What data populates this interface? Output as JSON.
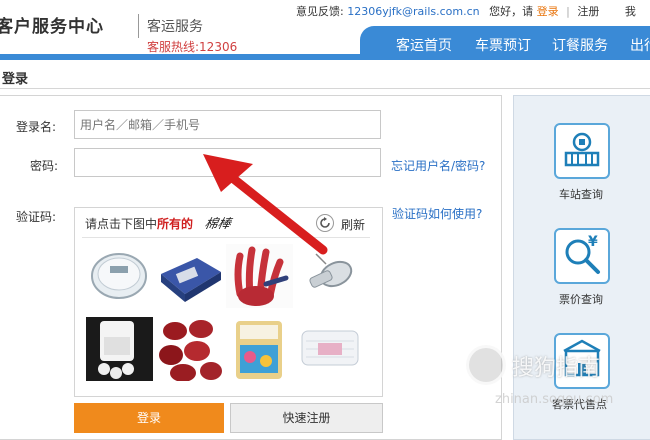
{
  "header": {
    "brand": "客户服务中心",
    "subtitle": "客运服务",
    "hotline": "客服热线:12306",
    "feedback_label": "意见反馈:",
    "feedback_email": "12306yjfk@rails.com.cn",
    "greeting": "您好，请",
    "login_link": "登录",
    "separator": "|",
    "register_link": "注册",
    "cut_link": "我"
  },
  "nav": {
    "items": [
      {
        "label": "客运首页"
      },
      {
        "label": "车票预订"
      },
      {
        "label": "订餐服务"
      },
      {
        "label": "出行"
      }
    ]
  },
  "section_title": "登录",
  "login": {
    "username_label": "登录名:",
    "username_placeholder": "用户名／邮箱／手机号",
    "password_label": "密码:",
    "forgot_link": "忘记用户名/密码?",
    "captcha_label": "验证码:",
    "captcha_help_link": "验证码如何使用?",
    "captcha_prompt_pre": "请点击下图中",
    "captcha_prompt_em": "所有的",
    "captcha_word": "棉棒",
    "refresh_label": "刷新",
    "captcha_images": [
      "scale",
      "calculator",
      "handprint",
      "whistle",
      "pill-bottle",
      "red-dates",
      "cotton-swab-box",
      "cotton-swab-pack"
    ],
    "login_button": "登录",
    "register_button": "快速注册"
  },
  "side": {
    "items": [
      {
        "label": "车站查询",
        "icon": "station-icon"
      },
      {
        "label": "票价查询",
        "icon": "fare-search-icon"
      },
      {
        "label": "客票代售点",
        "icon": "agency-icon"
      }
    ]
  },
  "watermark": {
    "text": "搜狗指南",
    "url": "zhinan.sogou.com"
  },
  "colors": {
    "nav_blue": "#3a8ad6",
    "orange_button": "#f08a1c",
    "link_blue": "#2a70c5",
    "arrow_red": "#d81e1e"
  }
}
